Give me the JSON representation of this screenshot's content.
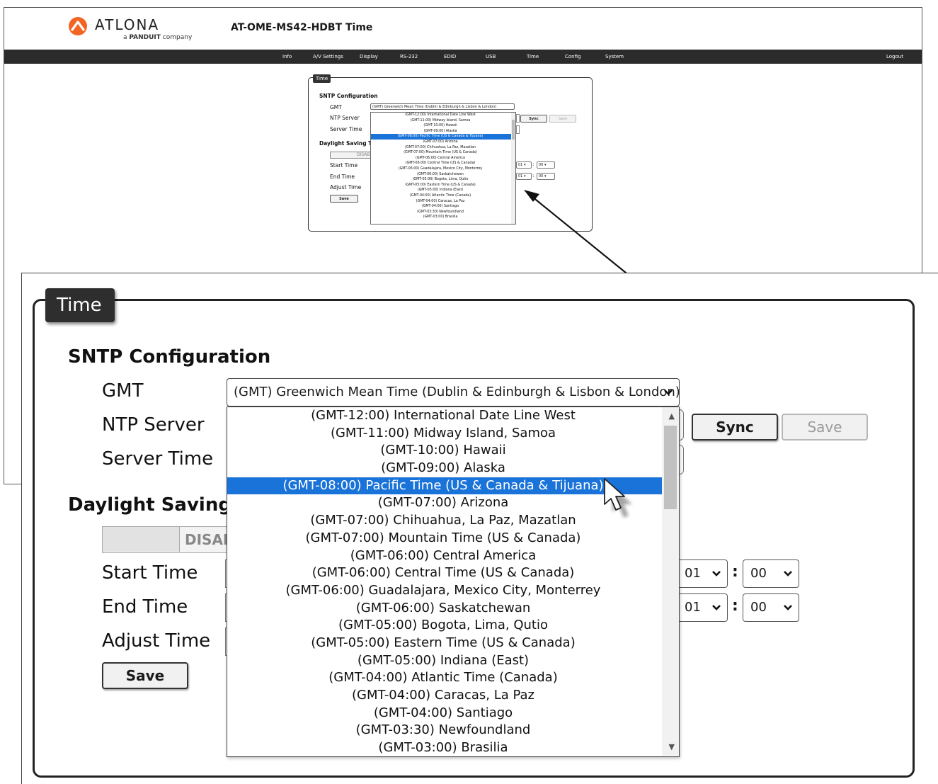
{
  "brand": {
    "name": "ATLONA",
    "tagline_prefix": "a",
    "tagline_brand": "PANDUIT",
    "tagline_suffix": "company"
  },
  "page_title": "AT-OME-MS42-HDBT  Time",
  "nav": [
    "Info",
    "A/V Settings",
    "Display",
    "RS-232",
    "EDID",
    "USB",
    "Time",
    "Config",
    "System"
  ],
  "logout": "Logout",
  "panel": {
    "tab_label": "Time",
    "sntp_heading": "SNTP Configuration",
    "gmt_label": "GMT",
    "gmt_selected": "(GMT) Greenwich Mean Time (Dublin & Edinburgh & Lisbon & London)",
    "ntp_label": "NTP Server",
    "server_time_label": "Server Time",
    "sync_button": "Sync",
    "save_button_ntp": "Save",
    "dst_heading": "Daylight Saving T",
    "dst_heading_small": "Daylight Saving T",
    "dst_toggle": "DISAB",
    "start_label": "Start Time",
    "end_label": "End Time",
    "adjust_label": "Adjust Time",
    "save_button": "Save",
    "start_hour": "01",
    "start_minute": "00",
    "end_hour": "01",
    "end_minute": "00",
    "colon": ":"
  },
  "timezone_options": [
    "(GMT-12:00) International Date Line West",
    "(GMT-11:00) Midway Island, Samoa",
    "(GMT-10:00) Hawaii",
    "(GMT-09:00) Alaska",
    "(GMT-08:00) Pacific Time (US & Canada & Tijuana)",
    "(GMT-07:00) Arizona",
    "(GMT-07:00) Chihuahua, La Paz, Mazatlan",
    "(GMT-07:00) Mountain Time (US & Canada)",
    "(GMT-06:00) Central America",
    "(GMT-06:00) Central Time (US & Canada)",
    "(GMT-06:00) Guadalajara, Mexico City, Monterrey",
    "(GMT-06:00) Saskatchewan",
    "(GMT-05:00) Bogota, Lima, Qutio",
    "(GMT-05:00) Eastern Time (US & Canada)",
    "(GMT-05:00) Indiana (East)",
    "(GMT-04:00) Atlantic Time (Canada)",
    "(GMT-04:00) Caracas, La Paz",
    "(GMT-04:00) Santiago",
    "(GMT-03:30) Newfoundland",
    "(GMT-03:00) Brasilia"
  ],
  "highlighted_index": 4,
  "colors": {
    "navbar": "#2b2b2b",
    "highlight": "#1a73d9",
    "logo_accent": "#f26522"
  }
}
